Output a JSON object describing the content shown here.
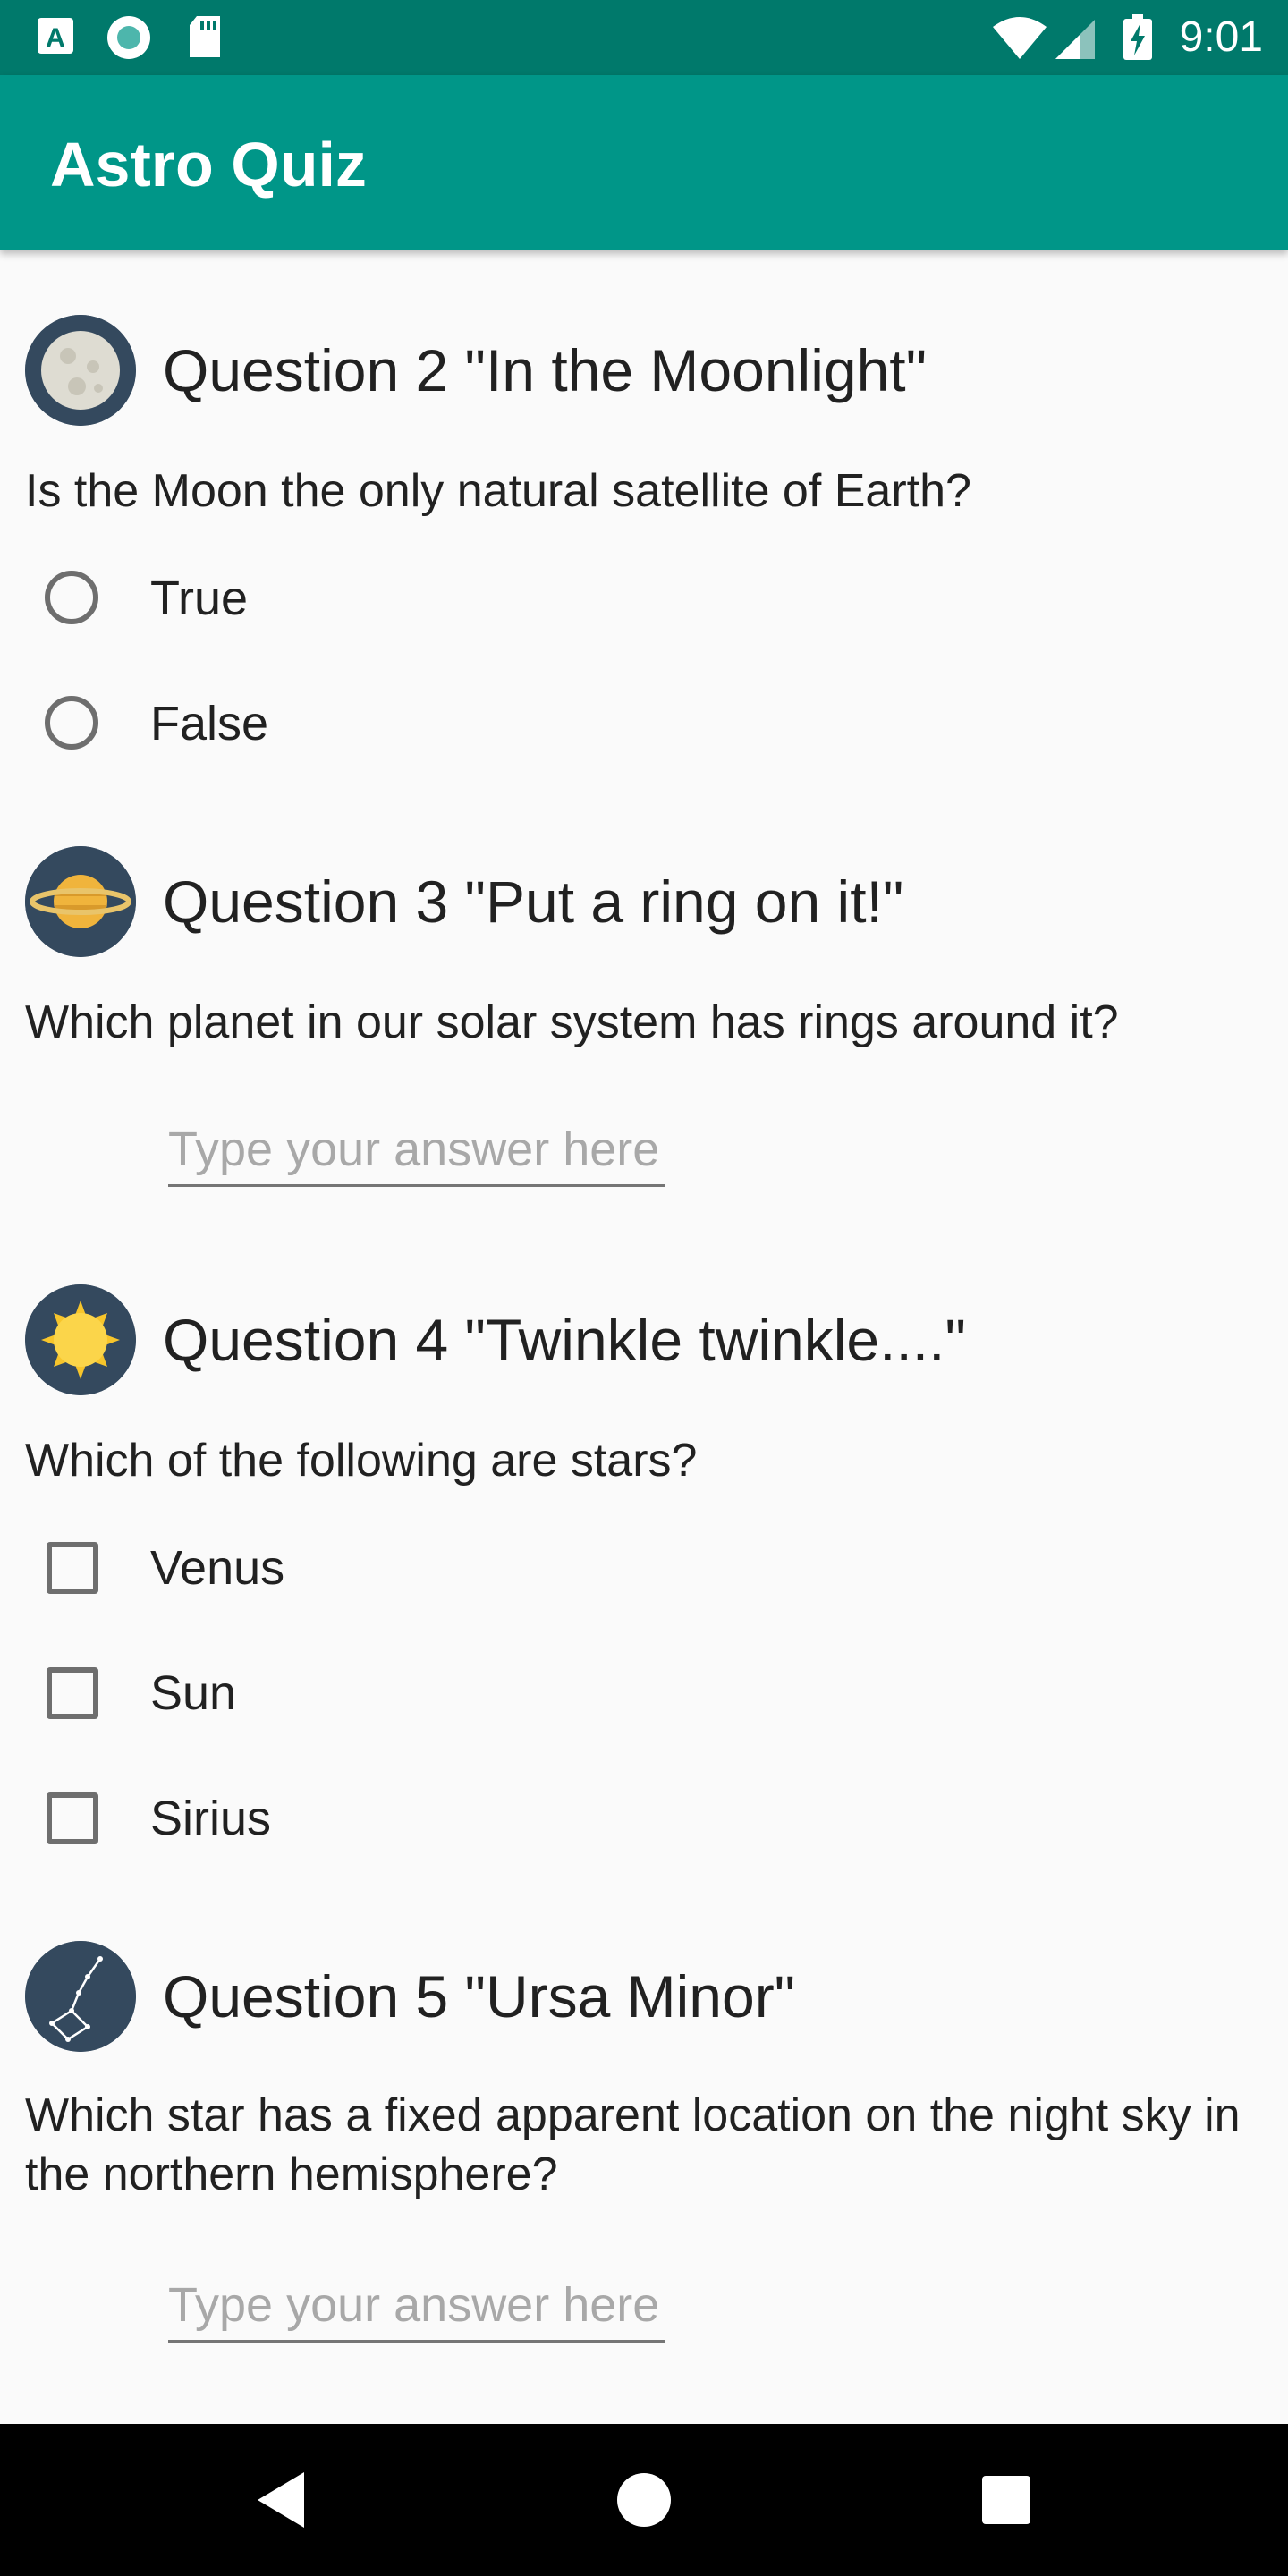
{
  "status_bar": {
    "time": "9:01",
    "icons": [
      "font-a-icon",
      "record-icon",
      "sd-card-icon",
      "wifi-icon",
      "signal-icon",
      "battery-charging-icon"
    ],
    "background": "#00796b"
  },
  "app_bar": {
    "title": "Astro Quiz",
    "background": "#009688"
  },
  "questions": [
    {
      "icon": "moon-icon",
      "title": "Question 2 \"In the Moonlight\"",
      "text": "Is the Moon the only natural satellite of Earth?",
      "type": "radio",
      "options": [
        "True",
        "False"
      ]
    },
    {
      "icon": "saturn-icon",
      "title": "Question 3 \"Put a ring on it!\"",
      "text": "Which planet in our solar system has rings around it?",
      "type": "text",
      "placeholder": "Type your answer here"
    },
    {
      "icon": "sun-icon",
      "title": "Question 4 \"Twinkle twinkle....\"",
      "text": "Which of the following are stars?",
      "type": "checkbox",
      "options": [
        "Venus",
        "Sun",
        "Sirius"
      ]
    },
    {
      "icon": "constellation-icon",
      "title": "Question 5 \"Ursa Minor\"",
      "text": "Which star has a fixed apparent location on the night sky in the northern hemisphere?",
      "type": "text",
      "placeholder": "Type your answer here"
    }
  ],
  "nav_bar": {
    "buttons": [
      "back-icon",
      "home-icon",
      "recents-icon"
    ]
  }
}
